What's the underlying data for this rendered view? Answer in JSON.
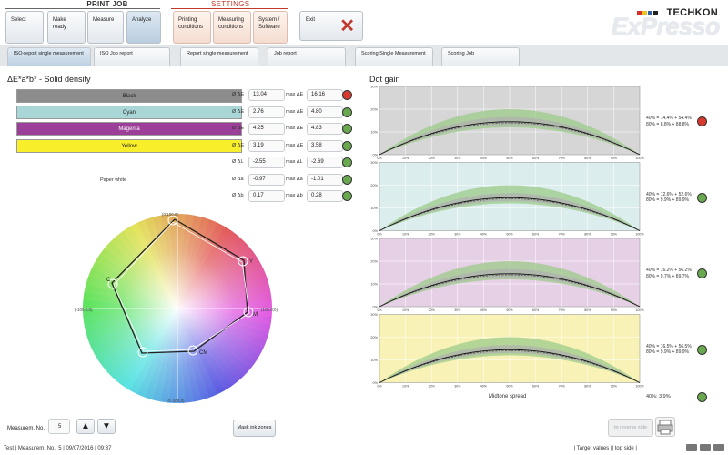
{
  "header": {
    "group_print": "PRINT JOB",
    "group_settings": "SETTINGS",
    "buttons": [
      {
        "label": "Select"
      },
      {
        "label": "Make ready"
      },
      {
        "label": "Measure"
      },
      {
        "label": "Analyze"
      },
      {
        "label": "Printing conditions"
      },
      {
        "label": "Measuring conditions"
      },
      {
        "label": "System / Software"
      }
    ],
    "exit": "Exit"
  },
  "logo": {
    "brand": "TECHKON",
    "product": "ExPresso"
  },
  "tabs": [
    {
      "label": "ISO-report single measurement"
    },
    {
      "label": "ISO Job report"
    },
    {
      "label": "Report single measurement"
    },
    {
      "label": "Job report"
    },
    {
      "label": "Scoring Single Measurement"
    },
    {
      "label": "Scoring Job"
    }
  ],
  "solid": {
    "title": "ΔE*a*b* - Solid density",
    "bars": [
      {
        "label": "Black",
        "color": "#8c8c8c"
      },
      {
        "label": "Cyan",
        "color": "#a9d6d6"
      },
      {
        "label": "Magenta",
        "color": "#9c3f99"
      },
      {
        "label": "Yellow",
        "color": "#f8ee2a"
      }
    ],
    "paper_white": "Paper white",
    "metrics": [
      {
        "avg_label": "Ø ΔE",
        "avg": "13.04",
        "max_label": "max ΔE",
        "max": "16.16",
        "status": "#d63a2f"
      },
      {
        "avg_label": "Ø ΔE",
        "avg": "2.76",
        "max_label": "max ΔE",
        "max": "4.80",
        "status": "#6aa84f"
      },
      {
        "avg_label": "Ø ΔE",
        "avg": "4.25",
        "max_label": "max ΔE",
        "max": "4.83",
        "status": "#6aa84f"
      },
      {
        "avg_label": "Ø ΔE",
        "avg": "3.19",
        "max_label": "max ΔE",
        "max": "3.58",
        "status": "#6aa84f"
      },
      {
        "avg_label": "Ø ΔL",
        "avg": "-2.55",
        "max_label": "max ΔL",
        "max": "-2.69",
        "status": "#6aa84f"
      },
      {
        "avg_label": "Ø Δa",
        "avg": "-0.97",
        "max_label": "max Δa",
        "max": "-1.01",
        "status": "#6aa84f"
      },
      {
        "avg_label": "Ø Δb",
        "avg": "0.17",
        "max_label": "max Δb",
        "max": "0.28",
        "status": "#6aa84f"
      }
    ],
    "wheel_labels": {
      "top": "(0;100.0)",
      "bottom": "(0;-100.0)",
      "left": "(-100.0;0)",
      "right": "(100.0;0)",
      "y": "Y",
      "m": "M",
      "cm": "CM",
      "c": "C"
    }
  },
  "dotgain": {
    "title": "Dot gain",
    "xticks": [
      "0%",
      "10%",
      "20%",
      "30%",
      "40%",
      "50%",
      "60%",
      "70%",
      "80%",
      "90%",
      "100%"
    ],
    "yticks": [
      "0%",
      "10%",
      "20%",
      "30%"
    ],
    "panels": [
      {
        "bg": "#d6d6d6",
        "l1": "40% = 14.4% + 54.4%",
        "l2": "80% = 8.8% + 88.8%",
        "status": "#d63a2f"
      },
      {
        "bg": "#dcedee",
        "l1": "40% = 12.6% + 52.6%",
        "l2": "80% = 9.9% + 89.9%",
        "status": "#6aa84f"
      },
      {
        "bg": "#e5d0e6",
        "l1": "40% = 16.2% + 56.2%",
        "l2": "80% = 9.7% + 89.7%",
        "status": "#6aa84f"
      },
      {
        "bg": "#f8f2b6",
        "l1": "40% = 16.5% + 56.5%",
        "l2": "80% = 9.9% + 89.9%",
        "status": "#6aa84f"
      }
    ],
    "xlabel": "Midtone spread",
    "spread": "40%: 3.9%",
    "spread_status": "#6aa84f"
  },
  "bottom": {
    "meas_label": "Measurem. No.",
    "meas_value": "5",
    "mask": "Mask ink zones",
    "reverse": "to reverse side"
  },
  "status": {
    "left": "Test | Measurem. No.: 5 | 09/07/2016 | 09:37",
    "target": "Target values",
    "side": "top side"
  }
}
